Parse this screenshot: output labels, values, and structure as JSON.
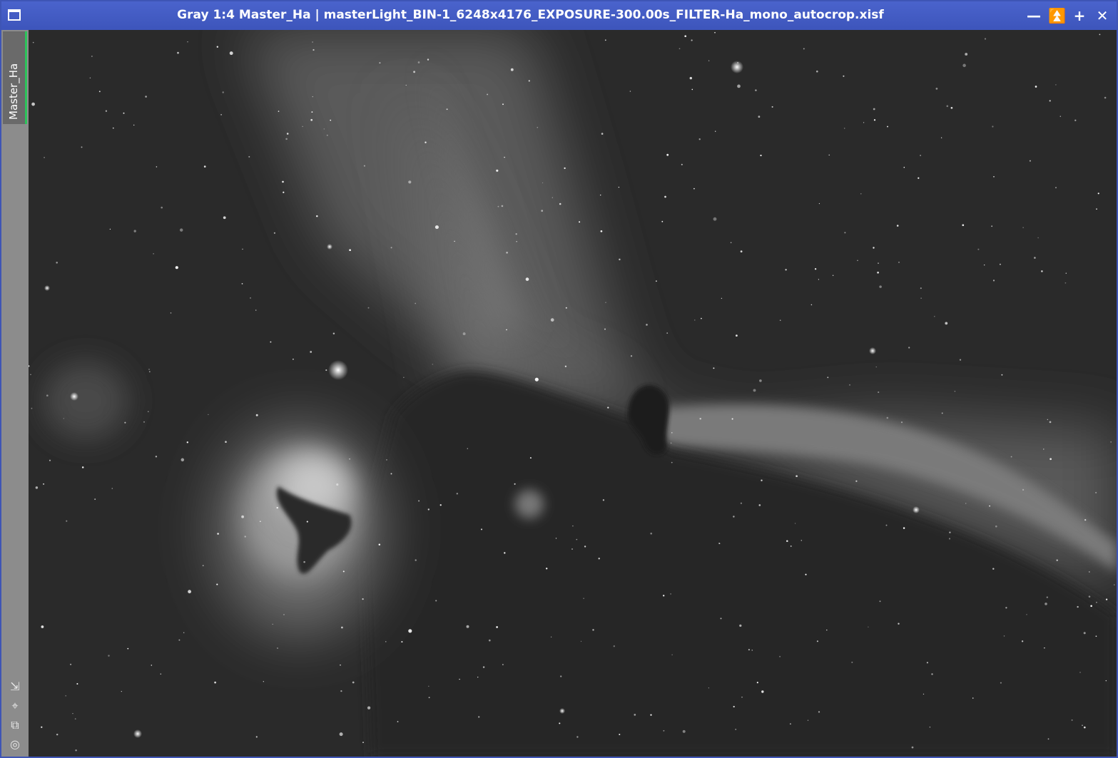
{
  "window": {
    "title": "Gray 1:4 Master_Ha | masterLight_BIN-1_6248x4176_EXPOSURE-300.00s_FILTER-Ha_mono_autocrop.xisf",
    "icon": "window-icon",
    "controls": [
      {
        "name": "minimize-button",
        "glyph": "−"
      },
      {
        "name": "shade-button",
        "glyph": "⩟"
      },
      {
        "name": "maximize-button",
        "glyph": "+"
      },
      {
        "name": "close-button",
        "glyph": "✕"
      }
    ],
    "controls_glyphs": {
      "minimize": "—",
      "shade": "⏫",
      "maximize": "+",
      "close": "✕"
    }
  },
  "sidebar": {
    "tab_label": "Master_Ha",
    "tab_accent": "#2cc35a",
    "tools": [
      {
        "icon": "resize-icon",
        "glyph": "⇲"
      },
      {
        "icon": "fit-view-icon",
        "glyph": "⌖"
      },
      {
        "icon": "clone-view-icon",
        "glyph": "⧉"
      },
      {
        "icon": "target-icon",
        "glyph": "◎"
      }
    ]
  },
  "image": {
    "subject": "astronomical-image",
    "mode": "grayscale",
    "zoom": "1:4"
  },
  "colors": {
    "titlebar": "#3d55bb",
    "sidebar": "#8c8c8c",
    "background": "#2c2c2c"
  }
}
